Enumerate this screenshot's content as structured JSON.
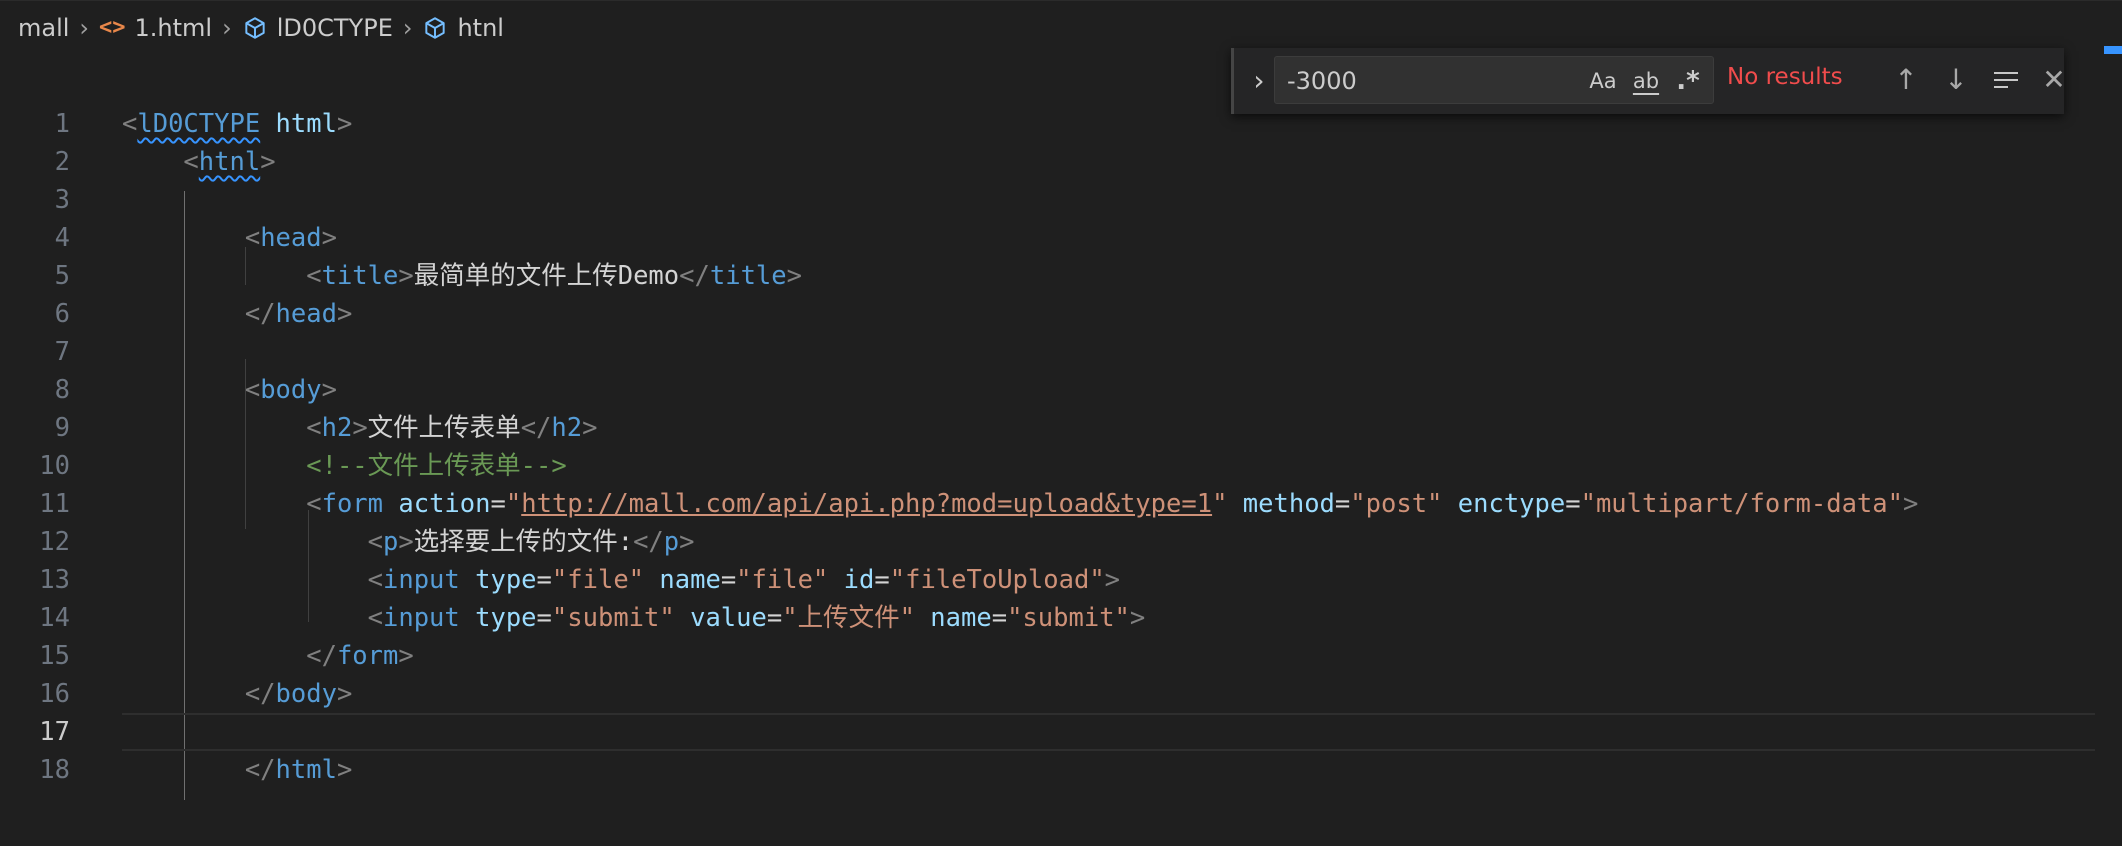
{
  "breadcrumb": {
    "folder": "mall",
    "file_icon": "code-icon",
    "file": "1.html",
    "node1_icon": "cube-icon",
    "node1": "lD0CTYPE",
    "node2_icon": "cube-icon",
    "node2": "htnl"
  },
  "find": {
    "toggle_icon": "chevron-right-icon",
    "query": "-3000",
    "match_case": "Aa",
    "whole_word": "ab",
    "regex": ".*",
    "status": "No results",
    "prev_icon": "arrow-up-icon",
    "next_icon": "arrow-down-icon",
    "selection_icon": "find-in-selection-icon",
    "close_icon": "close-icon"
  },
  "editor": {
    "current_line": 17,
    "lines": [
      {
        "n": "1",
        "tokens": [
          [
            "punc",
            "<"
          ],
          [
            "tag",
            "lD0CTYPE",
            "squig"
          ],
          [
            "text",
            " "
          ],
          [
            "attr",
            "html"
          ],
          [
            "punc",
            ">"
          ]
        ]
      },
      {
        "n": "2",
        "tokens": [
          [
            "text",
            "    "
          ],
          [
            "punc",
            "<"
          ],
          [
            "tag",
            "htnl",
            "squig"
          ],
          [
            "punc",
            ">"
          ]
        ]
      },
      {
        "n": "3",
        "tokens": []
      },
      {
        "n": "4",
        "tokens": [
          [
            "text",
            "        "
          ],
          [
            "punc",
            "<"
          ],
          [
            "tag",
            "head"
          ],
          [
            "punc",
            ">"
          ]
        ]
      },
      {
        "n": "5",
        "tokens": [
          [
            "text",
            "            "
          ],
          [
            "punc",
            "<"
          ],
          [
            "tag",
            "title"
          ],
          [
            "punc",
            ">"
          ],
          [
            "text",
            "最简单的文件上传Demo"
          ],
          [
            "punc",
            "</"
          ],
          [
            "tag",
            "title"
          ],
          [
            "punc",
            ">"
          ]
        ]
      },
      {
        "n": "6",
        "tokens": [
          [
            "text",
            "        "
          ],
          [
            "punc",
            "</"
          ],
          [
            "tag",
            "head"
          ],
          [
            "punc",
            ">"
          ]
        ]
      },
      {
        "n": "7",
        "tokens": []
      },
      {
        "n": "8",
        "tokens": [
          [
            "text",
            "        "
          ],
          [
            "punc",
            "<"
          ],
          [
            "tag",
            "body"
          ],
          [
            "punc",
            ">"
          ]
        ]
      },
      {
        "n": "9",
        "tokens": [
          [
            "text",
            "            "
          ],
          [
            "punc",
            "<"
          ],
          [
            "tag",
            "h2"
          ],
          [
            "punc",
            ">"
          ],
          [
            "text",
            "文件上传表单"
          ],
          [
            "punc",
            "</"
          ],
          [
            "tag",
            "h2"
          ],
          [
            "punc",
            ">"
          ]
        ]
      },
      {
        "n": "10",
        "tokens": [
          [
            "text",
            "            "
          ],
          [
            "cmt",
            "<!--文件上传表单-->"
          ]
        ]
      },
      {
        "n": "11",
        "tokens": [
          [
            "text",
            "            "
          ],
          [
            "punc",
            "<"
          ],
          [
            "tag",
            "form"
          ],
          [
            "text",
            " "
          ],
          [
            "attr",
            "action"
          ],
          [
            "text",
            "="
          ],
          [
            "str",
            "\""
          ],
          [
            "str",
            "http://mall.com/api/api.php?mod=upload&type=1",
            "link"
          ],
          [
            "str",
            "\""
          ],
          [
            "text",
            " "
          ],
          [
            "attr",
            "method"
          ],
          [
            "text",
            "="
          ],
          [
            "str",
            "\"post\""
          ],
          [
            "text",
            " "
          ],
          [
            "attr",
            "enctype"
          ],
          [
            "text",
            "="
          ],
          [
            "str",
            "\"multipart/form-data\""
          ],
          [
            "punc",
            ">"
          ]
        ]
      },
      {
        "n": "12",
        "tokens": [
          [
            "text",
            "                "
          ],
          [
            "punc",
            "<"
          ],
          [
            "tag",
            "p"
          ],
          [
            "punc",
            ">"
          ],
          [
            "text",
            "选择要上传的文件:"
          ],
          [
            "punc",
            "</"
          ],
          [
            "tag",
            "p"
          ],
          [
            "punc",
            ">"
          ]
        ]
      },
      {
        "n": "13",
        "tokens": [
          [
            "text",
            "                "
          ],
          [
            "punc",
            "<"
          ],
          [
            "tag",
            "input"
          ],
          [
            "text",
            " "
          ],
          [
            "attr",
            "type"
          ],
          [
            "text",
            "="
          ],
          [
            "str",
            "\"file\""
          ],
          [
            "text",
            " "
          ],
          [
            "attr",
            "name"
          ],
          [
            "text",
            "="
          ],
          [
            "str",
            "\"file\""
          ],
          [
            "text",
            " "
          ],
          [
            "attr",
            "id"
          ],
          [
            "text",
            "="
          ],
          [
            "str",
            "\"fileToUpload\""
          ],
          [
            "punc",
            ">"
          ]
        ]
      },
      {
        "n": "14",
        "tokens": [
          [
            "text",
            "                "
          ],
          [
            "punc",
            "<"
          ],
          [
            "tag",
            "input"
          ],
          [
            "text",
            " "
          ],
          [
            "attr",
            "type"
          ],
          [
            "text",
            "="
          ],
          [
            "str",
            "\"submit\""
          ],
          [
            "text",
            " "
          ],
          [
            "attr",
            "value"
          ],
          [
            "text",
            "="
          ],
          [
            "str",
            "\"上传文件\""
          ],
          [
            "text",
            " "
          ],
          [
            "attr",
            "name"
          ],
          [
            "text",
            "="
          ],
          [
            "str",
            "\"submit\""
          ],
          [
            "punc",
            ">"
          ]
        ]
      },
      {
        "n": "15",
        "tokens": [
          [
            "text",
            "            "
          ],
          [
            "punc",
            "</"
          ],
          [
            "tag",
            "form"
          ],
          [
            "punc",
            ">"
          ]
        ]
      },
      {
        "n": "16",
        "tokens": [
          [
            "text",
            "        "
          ],
          [
            "punc",
            "</"
          ],
          [
            "tag",
            "body"
          ],
          [
            "punc",
            ">"
          ]
        ]
      },
      {
        "n": "17",
        "tokens": []
      },
      {
        "n": "18",
        "tokens": [
          [
            "text",
            "        "
          ],
          [
            "punc",
            "</"
          ],
          [
            "tag",
            "html"
          ],
          [
            "punc",
            ">"
          ]
        ]
      }
    ]
  }
}
